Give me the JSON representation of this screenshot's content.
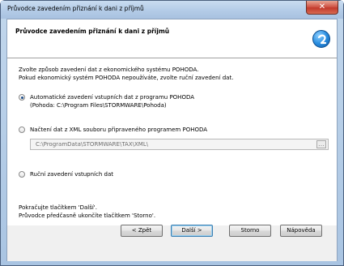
{
  "window": {
    "title": "Průvodce zavedením přiznání k dani z příjmů",
    "close_glyph": "✕"
  },
  "header": {
    "title": "Průvodce zavedením přiznání k dani z příjmů",
    "logo_icon": "pohoda-logo-icon"
  },
  "intro": {
    "line1": "Zvolte způsob zavedení dat z ekonomického systému POHODA.",
    "line2": "Pokud ekonomický systém POHODA nepoužíváte, zvolte ruční zavedení dat."
  },
  "options": [
    {
      "label": "Automatické zavedení vstupních dat z programu POHODA",
      "sub": "(Pohoda: C:\\Program Files\\STORMWARE\\Pohoda)",
      "checked": true
    },
    {
      "label": "Načtení dat z XML souboru připraveného programem POHODA",
      "checked": false
    },
    {
      "label": "Ruční zavedení vstupních dat",
      "checked": false
    }
  ],
  "xml_path": {
    "value": "C:\\ProgramData\\STORMWARE\\TAX\\XML\\",
    "browse_glyph": "…"
  },
  "footer": {
    "line1": "Pokračujte tlačítkem 'Další'.",
    "line2": "Průvodce předčasně ukončíte tlačítkem 'Storno'."
  },
  "buttons": {
    "back": "< Zpět",
    "next": "Další >",
    "cancel": "Storno",
    "help": "Nápověda"
  }
}
